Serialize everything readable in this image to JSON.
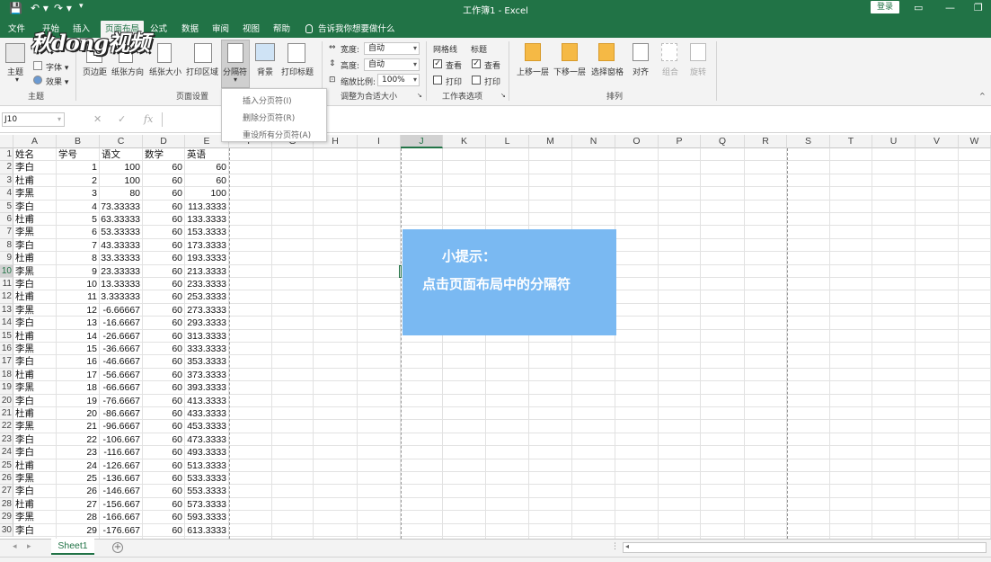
{
  "titlebar": {
    "doc_title": "工作簿1 - Excel",
    "login": "登录",
    "quick_access": [
      "💾",
      "↶ ▾",
      "↷ ▾",
      "▾"
    ],
    "win_controls": [
      "▭",
      "—",
      "❐"
    ]
  },
  "tabs": [
    "文件",
    "开始",
    "插入",
    "页面布局",
    "公式",
    "数据",
    "审阅",
    "视图",
    "帮助"
  ],
  "active_tab": "页面布局",
  "tellme": "告诉我你想要做什么",
  "watermark": "秋dong视频",
  "ribbon": {
    "themes": {
      "btn": "主题",
      "colors": "字体 ▾",
      "effects": "效果 ▾",
      "group": "主题"
    },
    "page_setup": {
      "buttons": [
        "页边距",
        "纸张方向",
        "纸张大小",
        "打印区域",
        "分隔符",
        "背景",
        "打印标题"
      ],
      "group": "页面设置"
    },
    "scale": {
      "width_label": "宽度:",
      "width_val": "自动",
      "height_label": "高度:",
      "height_val": "自动",
      "scale_label": "缩放比例:",
      "scale_val": "100%",
      "group": "调整为合适大小"
    },
    "sheet_opts": {
      "grid_label": "网格线",
      "head_label": "标题",
      "view": "查看",
      "print": "打印",
      "group": "工作表选项"
    },
    "arrange": {
      "buttons": [
        "上移一层",
        "下移一层",
        "选择窗格",
        "对齐",
        "组合",
        "旋转"
      ],
      "group": "排列"
    }
  },
  "breaks_menu": [
    "插入分页符(I)",
    "删除分页符(R)",
    "重设所有分页符(A)"
  ],
  "formula": {
    "namebox": "J10",
    "cancel": "✕",
    "enter": "✓",
    "fx": "fx",
    "value": ""
  },
  "columns": [
    "A",
    "B",
    "C",
    "D",
    "E",
    "F",
    "G",
    "H",
    "I",
    "J",
    "K",
    "L",
    "M",
    "N",
    "O",
    "P",
    "Q",
    "R",
    "S",
    "T",
    "U",
    "V",
    "W"
  ],
  "selected_col": "J",
  "selected_row": "10",
  "row_numbers": [
    "1",
    "2",
    "3",
    "4",
    "5",
    "6",
    "7",
    "8",
    "9",
    "10",
    "11",
    "12",
    "13",
    "14",
    "15",
    "16",
    "17",
    "18",
    "19",
    "20",
    "21",
    "22",
    "23",
    "24",
    "25",
    "26",
    "27",
    "28",
    "29",
    "30"
  ],
  "headers": [
    "姓名",
    "学号",
    "语文",
    "数学",
    "英语"
  ],
  "rows": [
    [
      "李白",
      "1",
      "100",
      "60",
      "60"
    ],
    [
      "杜甫",
      "2",
      "100",
      "60",
      "60"
    ],
    [
      "李黑",
      "3",
      "80",
      "60",
      "100"
    ],
    [
      "李白",
      "4",
      "73.33333",
      "60",
      "113.3333"
    ],
    [
      "杜甫",
      "5",
      "63.33333",
      "60",
      "133.3333"
    ],
    [
      "李黑",
      "6",
      "53.33333",
      "60",
      "153.3333"
    ],
    [
      "李白",
      "7",
      "43.33333",
      "60",
      "173.3333"
    ],
    [
      "杜甫",
      "8",
      "33.33333",
      "60",
      "193.3333"
    ],
    [
      "李黑",
      "9",
      "23.33333",
      "60",
      "213.3333"
    ],
    [
      "李白",
      "10",
      "13.33333",
      "60",
      "233.3333"
    ],
    [
      "杜甫",
      "11",
      "3.333333",
      "60",
      "253.3333"
    ],
    [
      "李黑",
      "12",
      "-6.66667",
      "60",
      "273.3333"
    ],
    [
      "李白",
      "13",
      "-16.6667",
      "60",
      "293.3333"
    ],
    [
      "杜甫",
      "14",
      "-26.6667",
      "60",
      "313.3333"
    ],
    [
      "李黑",
      "15",
      "-36.6667",
      "60",
      "333.3333"
    ],
    [
      "李白",
      "16",
      "-46.6667",
      "60",
      "353.3333"
    ],
    [
      "杜甫",
      "17",
      "-56.6667",
      "60",
      "373.3333"
    ],
    [
      "李黑",
      "18",
      "-66.6667",
      "60",
      "393.3333"
    ],
    [
      "李白",
      "19",
      "-76.6667",
      "60",
      "413.3333"
    ],
    [
      "杜甫",
      "20",
      "-86.6667",
      "60",
      "433.3333"
    ],
    [
      "李黑",
      "21",
      "-96.6667",
      "60",
      "453.3333"
    ],
    [
      "李白",
      "22",
      "-106.667",
      "60",
      "473.3333"
    ],
    [
      "李白",
      "23",
      "-116.667",
      "60",
      "493.3333"
    ],
    [
      "杜甫",
      "24",
      "-126.667",
      "60",
      "513.3333"
    ],
    [
      "李黑",
      "25",
      "-136.667",
      "60",
      "533.3333"
    ],
    [
      "李白",
      "26",
      "-146.667",
      "60",
      "553.3333"
    ],
    [
      "杜甫",
      "27",
      "-156.667",
      "60",
      "573.3333"
    ],
    [
      "李黑",
      "28",
      "-166.667",
      "60",
      "593.3333"
    ],
    [
      "李白",
      "29",
      "-176.667",
      "60",
      "613.3333"
    ]
  ],
  "tip": {
    "title": "小提示：",
    "body": "点击页面布局中的分隔符"
  },
  "sheet": {
    "tab": "Sheet1",
    "add": "+",
    "nav": [
      "◂",
      "▸"
    ]
  },
  "colors": {
    "excel_green": "#217346",
    "tip_blue": "#7ab9f2"
  }
}
